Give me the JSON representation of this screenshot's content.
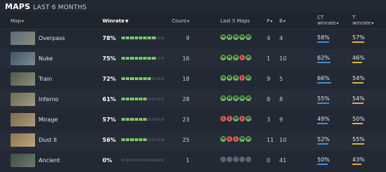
{
  "title": {
    "main": "MAPS",
    "sub": "LAST 6 MONTHS"
  },
  "headers": {
    "map": "Map",
    "winrate": "Winrate",
    "count": "Count",
    "last5": "Last 5 Maps",
    "p": "P",
    "b": "B",
    "ct": "CT\nwinrate",
    "t": "T\nwinrate"
  },
  "colors": {
    "win": "#6dbb5c",
    "loss": "#d65b5b",
    "ct": "#3b8fd9",
    "t": "#e0b03c",
    "bar": "#7cc36a"
  },
  "rows": [
    {
      "map": "Overpass",
      "winrate": "78%",
      "winrate_fraction": 0.78,
      "count": "9",
      "last5": [
        "W",
        "W",
        "W",
        "W",
        "W"
      ],
      "p": "4",
      "b": "4",
      "ct": "58%",
      "t": "57%",
      "thumb": [
        "#5b6b78",
        "#8c8a7e"
      ]
    },
    {
      "map": "Nuke",
      "winrate": "75%",
      "winrate_fraction": 0.75,
      "count": "16",
      "last5": [
        "W",
        "W",
        "W",
        "L",
        "W"
      ],
      "p": "1",
      "b": "10",
      "ct": "62%",
      "t": "46%",
      "thumb": [
        "#3e5566",
        "#7c8b8f"
      ]
    },
    {
      "map": "Train",
      "winrate": "72%",
      "winrate_fraction": 0.72,
      "count": "18",
      "last5": [
        "W",
        "W",
        "W",
        "L",
        "W"
      ],
      "p": "9",
      "b": "5",
      "ct": "66%",
      "t": "54%",
      "thumb": [
        "#4e5a4a",
        "#8a8c7c"
      ]
    },
    {
      "map": "Inferno",
      "winrate": "61%",
      "winrate_fraction": 0.61,
      "count": "28",
      "last5": [
        "W",
        "W",
        "W",
        "W",
        "W"
      ],
      "p": "8",
      "b": "8",
      "ct": "55%",
      "t": "54%",
      "thumb": [
        "#6a6a55",
        "#a09a80"
      ]
    },
    {
      "map": "Mirage",
      "winrate": "57%",
      "winrate_fraction": 0.57,
      "count": "23",
      "last5": [
        "L",
        "L",
        "W",
        "L",
        "W"
      ],
      "p": "3",
      "b": "9",
      "ct": "49%",
      "t": "50%",
      "thumb": [
        "#7a6a50",
        "#b09b78"
      ]
    },
    {
      "map": "Dust II",
      "winrate": "56%",
      "winrate_fraction": 0.56,
      "count": "25",
      "last5": [
        "W",
        "L",
        "L",
        "W",
        "W"
      ],
      "p": "11",
      "b": "10",
      "ct": "52%",
      "t": "55%",
      "thumb": [
        "#8a7656",
        "#c0a47a"
      ]
    },
    {
      "map": "Ancient",
      "winrate": "0%",
      "winrate_fraction": 0.0,
      "count": "1",
      "last5": [
        "N",
        "N",
        "N",
        "N",
        "N"
      ],
      "p": "0",
      "b": "41",
      "ct": "50%",
      "t": "43%",
      "thumb": [
        "#3f4f45",
        "#6c7a6a"
      ]
    }
  ]
}
